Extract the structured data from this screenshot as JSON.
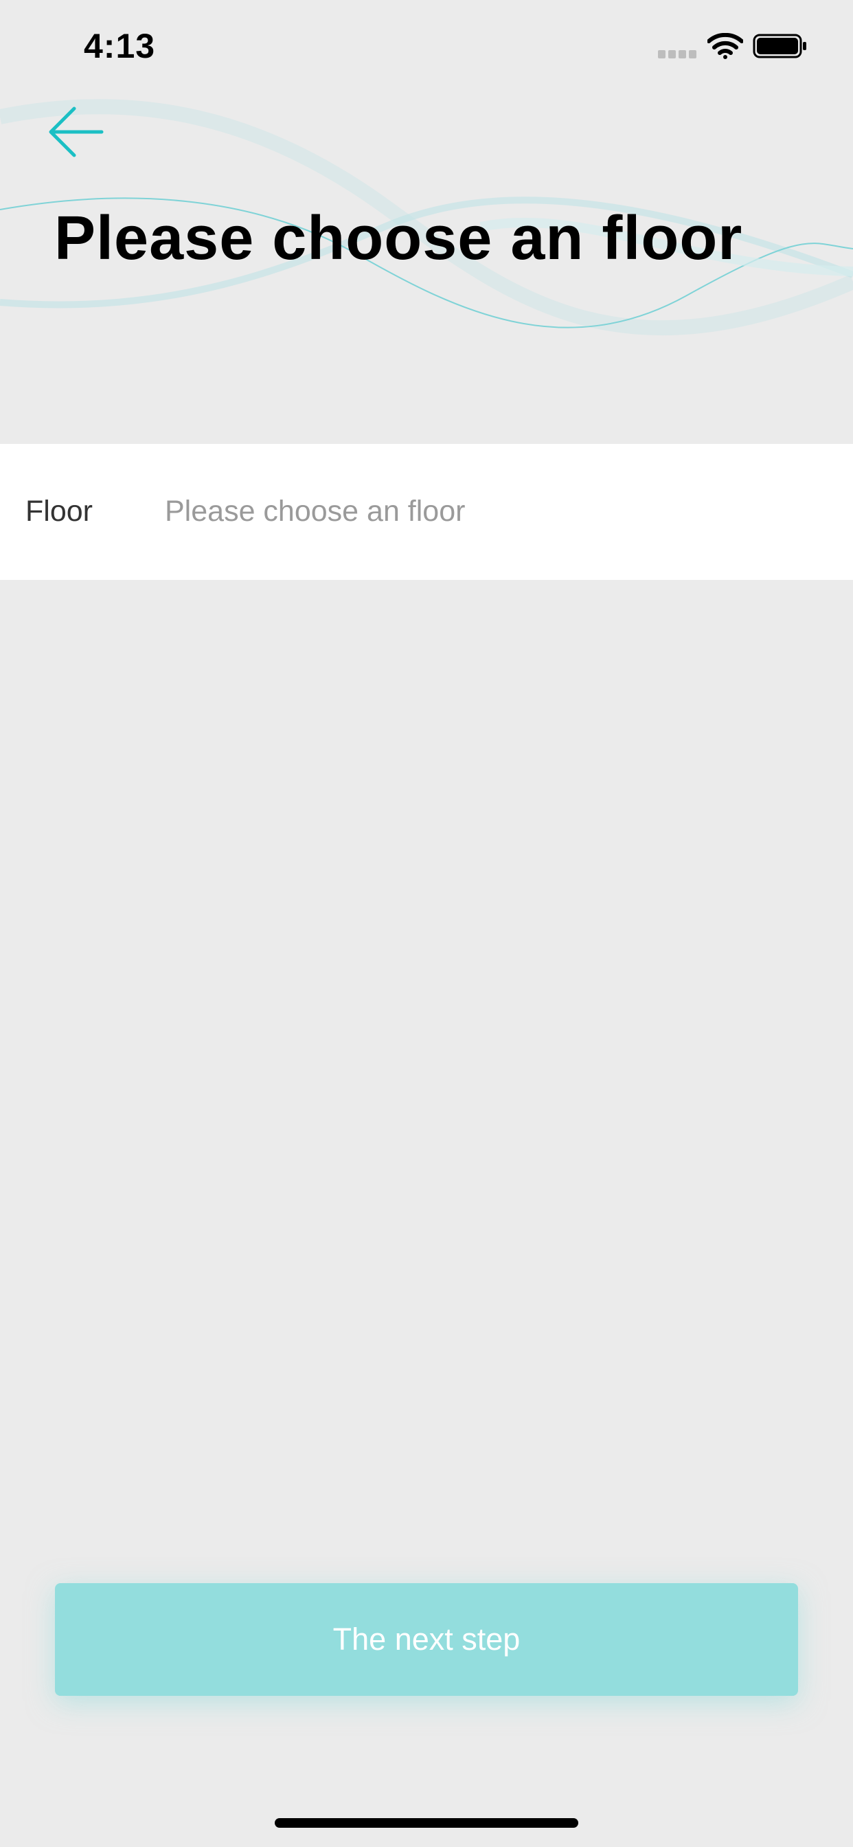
{
  "status_bar": {
    "time": "4:13"
  },
  "header": {
    "back_icon": "arrow-left-icon",
    "title": "Please choose an floor"
  },
  "form": {
    "floor_label": "Floor",
    "floor_placeholder": "Please choose an floor"
  },
  "footer": {
    "next_label": "The next step"
  },
  "colors": {
    "accent": "#1bbfc4",
    "button_disabled": "#93dddd",
    "background": "#ebebeb",
    "row_background": "#ffffff",
    "placeholder_text": "#9a9a9a"
  }
}
